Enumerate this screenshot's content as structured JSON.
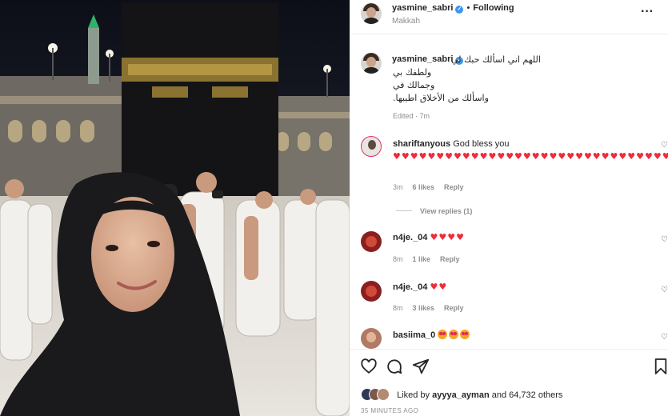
{
  "post": {
    "author": "yasmine_sabri",
    "follow_status": "Following",
    "separator": "•",
    "location": "Makkah",
    "more": "···"
  },
  "caption": {
    "username": "yasmine_sabri",
    "lines": [
      "اللهم اني اسألك حبك لي",
      "ولطفك بي",
      "وجمالك في",
      "واسألك من الأخلاق اطيبها."
    ],
    "edited": "Edited · 7m"
  },
  "comments": [
    {
      "username": "shariftanyous",
      "text": "God bless you",
      "emoji": "♥♥♥♥♥♥♥♥♥♥♥♥♥♥♥♥♥♥♥♥♥♥♥♥♥♥♥♥♥♥♥♥♥♥",
      "time": "3m",
      "likes": "6 likes",
      "reply": "Reply",
      "view_replies": "View replies (1)",
      "avatar_color": "#e9e4df"
    },
    {
      "username": "n4je._04",
      "emoji": "♥♥♥♥",
      "time": "8m",
      "likes": "1 like",
      "reply": "Reply",
      "avatar_color": "#8a1f1f"
    },
    {
      "username": "n4je._04",
      "emoji": "♥♥",
      "time": "8m",
      "likes": "3 likes",
      "reply": "Reply",
      "avatar_color": "#8a1f1f"
    },
    {
      "username": "basiima_0",
      "avatar_color": "#b07a64"
    }
  ],
  "actions": {
    "liked_by_prefix": "Liked by",
    "liked_by_user": "ayyya_ayman",
    "liked_by_suffix": "and 64,732 others",
    "time_ago": "35 MINUTES AGO"
  },
  "colors": {
    "verified": "#3897f0",
    "heart": "#ed2c3a",
    "muted": "#8e8e8e",
    "text": "#262626"
  }
}
